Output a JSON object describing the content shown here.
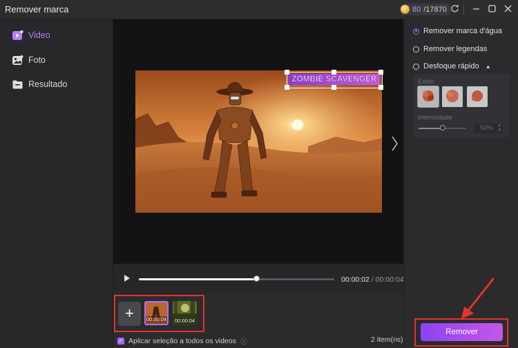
{
  "window": {
    "title": "Remover marca"
  },
  "credits": {
    "used": "80",
    "total": "/17870"
  },
  "sidebar": {
    "items": [
      {
        "label": "Video",
        "icon": "video-icon",
        "active": true
      },
      {
        "label": "Foto",
        "icon": "photo-icon",
        "active": false
      },
      {
        "label": "Resultado",
        "icon": "folder-icon",
        "active": false
      }
    ]
  },
  "preview": {
    "watermark_text": "ZOMBIE SCAVENGER"
  },
  "player": {
    "current_time": "00:00:02",
    "separator": "/",
    "duration": "00:00:04",
    "progress": 0.6
  },
  "thumbnails": [
    {
      "duration": "00:00:04",
      "selected": true
    },
    {
      "duration": "00:00:04",
      "selected": false
    }
  ],
  "footer": {
    "apply_label": "Aplicar seleção a todos os videos",
    "info_icon": "ⓘ",
    "item_count": "2 item(ns)"
  },
  "options": {
    "remove_watermark": "Remover marca d'água",
    "remove_subtitles": "Remover legendas",
    "quick_blur": "Desfoque rápido",
    "selected": "remove_watermark",
    "style_label": "Estilo",
    "intensity_label": "Intensidade",
    "intensity_value": "50%"
  },
  "actions": {
    "remove_label": "Remover"
  },
  "colors": {
    "accent": "#a56cff",
    "highlight_frame": "#e5332a"
  }
}
